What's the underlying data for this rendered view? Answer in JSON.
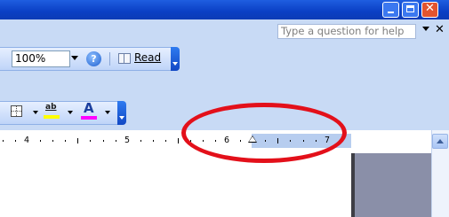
{
  "help": {
    "placeholder_text": "Type a question for help"
  },
  "toolbar": {
    "zoom_value": "100%",
    "read_label": "Read"
  },
  "ruler": {
    "numbers": [
      "4",
      "5",
      "6",
      "7"
    ]
  },
  "colors": {
    "title_bar": "#0a3fc4",
    "toolbar_bg": "#c8daf5",
    "highlight": "#ffff00",
    "font_color": "#ff00ff",
    "annotation": "#e3101a"
  },
  "icons": [
    "minimize-icon",
    "maximize-icon",
    "close-icon",
    "help-icon",
    "read-book-icon",
    "border-icon",
    "highlight-icon",
    "font-color-icon",
    "scroll-up-icon",
    "indent-marker-icon"
  ]
}
